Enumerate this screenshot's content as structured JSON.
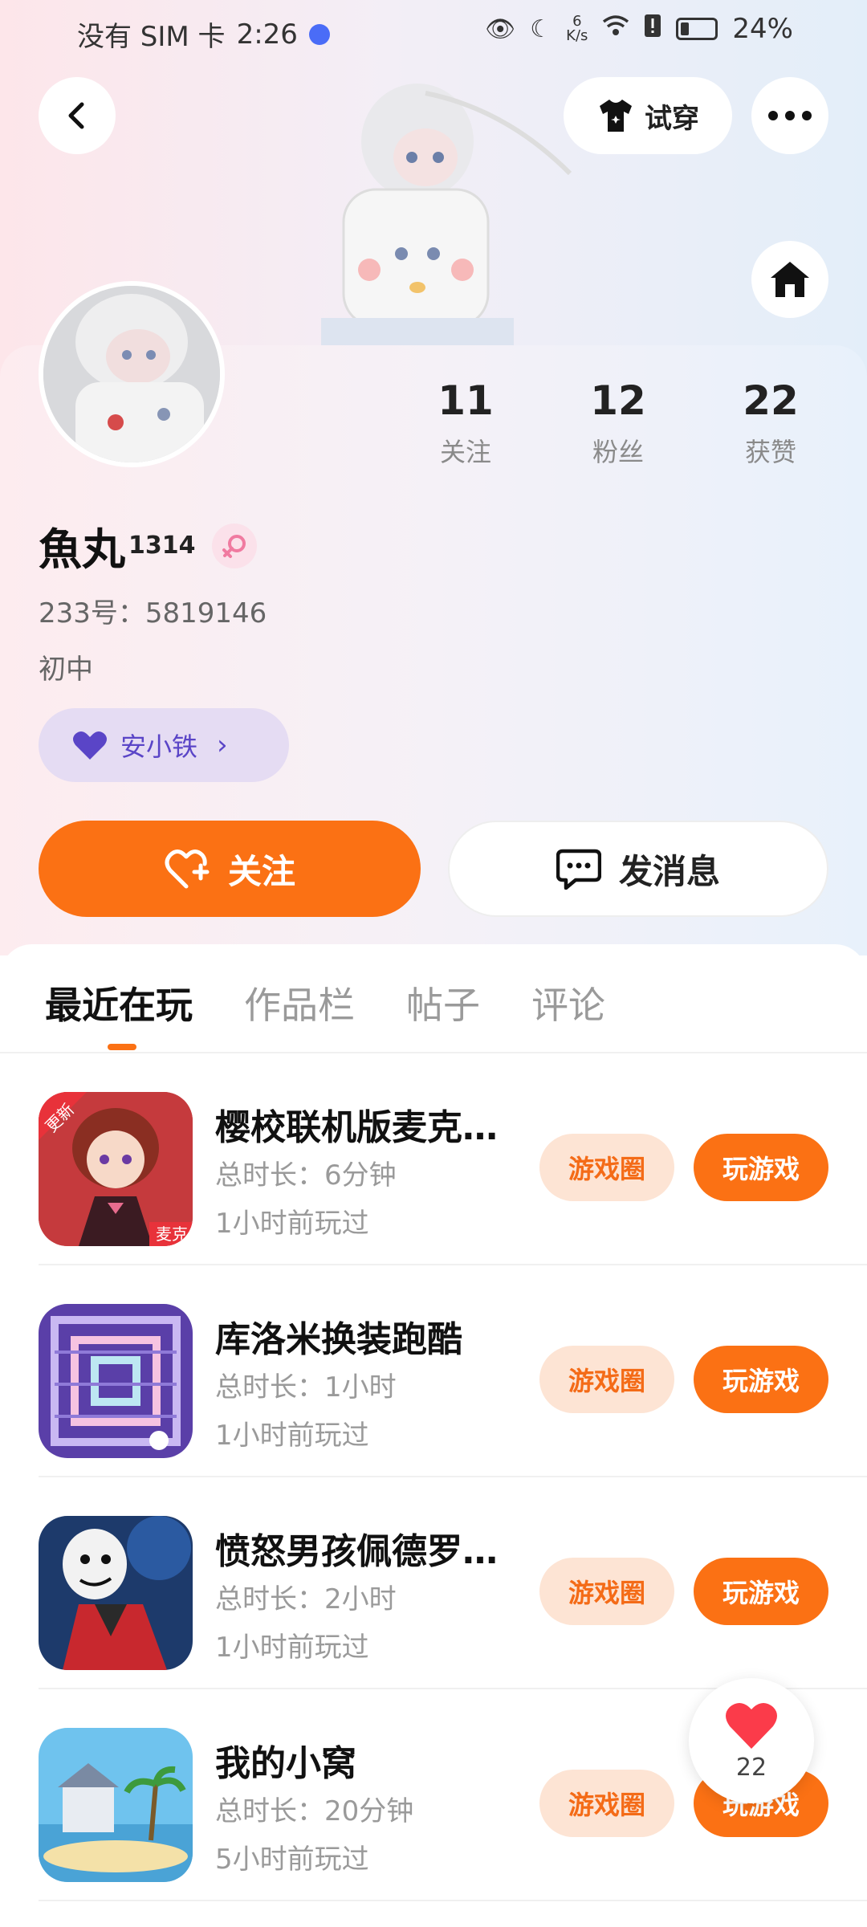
{
  "status_bar": {
    "carrier": "没有 SIM 卡",
    "time": "2:26",
    "speed_value": "6",
    "speed_unit": "K/s",
    "battery": "24%",
    "battery_level": 0.24
  },
  "header": {
    "tryon_label": "试穿"
  },
  "profile": {
    "name": "魚丸",
    "name_suffix": "1314",
    "uid": "233号：5819146",
    "grade": "初中",
    "badge_label": "安小铁",
    "stats": [
      {
        "value": "11",
        "label": "关注"
      },
      {
        "value": "12",
        "label": "粉丝"
      },
      {
        "value": "22",
        "label": "获赞"
      }
    ],
    "follow_label": "关注",
    "message_label": "发消息"
  },
  "tabs": [
    "最近在玩",
    "作品栏",
    "帖子",
    "评论"
  ],
  "games": [
    {
      "title": "樱校联机版麦克…",
      "duration": "总时长：6分钟",
      "last_played": "1小时前玩过",
      "icon_badge": "更新",
      "icon_label": "麦克"
    },
    {
      "title": "库洛米换装跑酷",
      "duration": "总时长：1小时",
      "last_played": "1小时前玩过"
    },
    {
      "title": "愤怒男孩佩德罗…",
      "duration": "总时长：2小时",
      "last_played": "1小时前玩过"
    },
    {
      "title": "我的小窝",
      "duration": "总时长：20分钟",
      "last_played": "5小时前玩过"
    }
  ],
  "game_buttons": {
    "circle_label": "游戏圈",
    "play_label": "玩游戏"
  },
  "floating_like": {
    "count": "22"
  },
  "colors": {
    "accent": "#fb7114",
    "accent_light": "#fde4d4",
    "badge_bg": "#e5dcf3",
    "badge_text": "#5a45c7"
  }
}
